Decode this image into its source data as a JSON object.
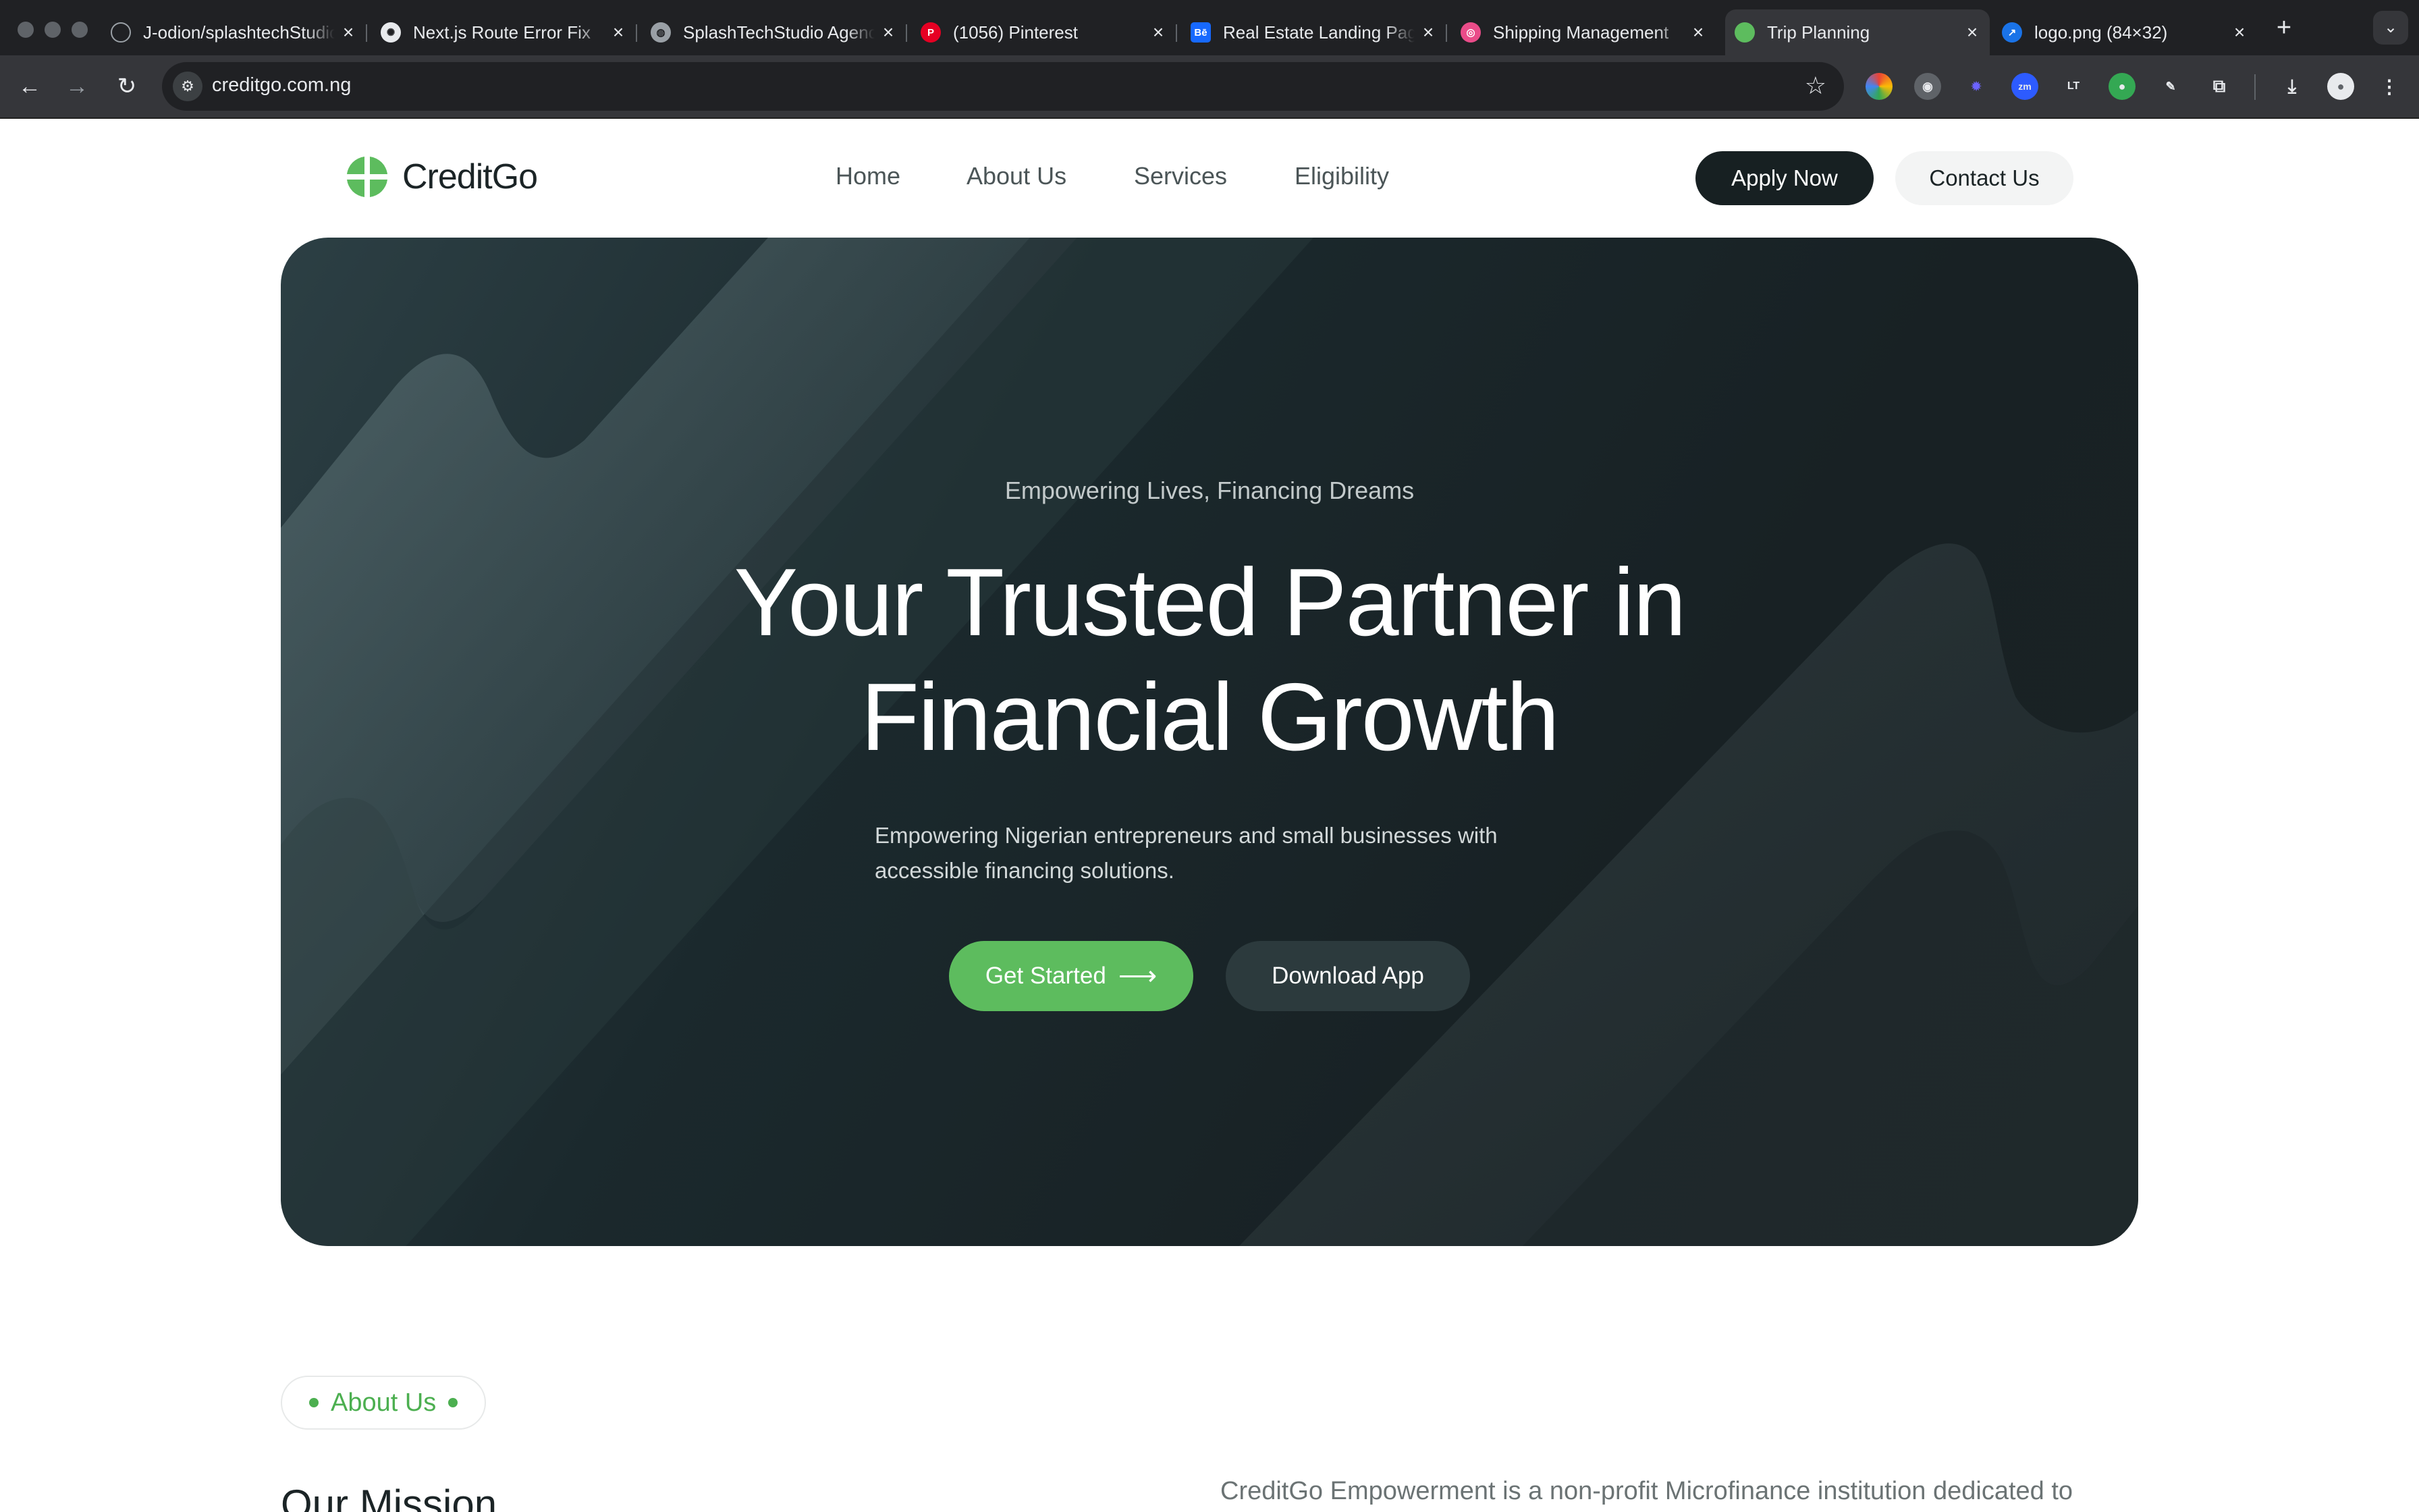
{
  "browser": {
    "tabs": [
      {
        "title": "J-odion/splashtechStudio",
        "icon": "github-icon"
      },
      {
        "title": "Next.js Route Error Fix",
        "icon": "openai-icon"
      },
      {
        "title": "SplashTechStudio Agency",
        "icon": "globe-icon"
      },
      {
        "title": "(1056) Pinterest",
        "icon": "pinterest-icon"
      },
      {
        "title": "Real Estate Landing Page",
        "icon": "behance-icon"
      },
      {
        "title": "Shipping Management",
        "icon": "dribbble-icon"
      },
      {
        "title": "Trip Planning",
        "icon": "creditgo-icon",
        "active": true
      },
      {
        "title": "logo.png (84×32)",
        "icon": "image-icon"
      }
    ],
    "url": "creditgo.com.ng",
    "tab_new": "+"
  },
  "site": {
    "brand": "CreditGo",
    "brand_color": "#5dbc5e",
    "nav": [
      "Home",
      "About Us",
      "Services",
      "Eligibility"
    ],
    "apply_label": "Apply Now",
    "contact_label": "Contact Us"
  },
  "hero": {
    "eyebrow": "Empowering Lives, Financing Dreams",
    "headline_line1": "Your Trusted Partner in",
    "headline_line2": "Financial Growth",
    "subtext_line1": "Empowering Nigerian entrepreneurs and small businesses with",
    "subtext_line2": "accessible financing solutions.",
    "primary_cta": "Get Started",
    "secondary_cta": "Download App"
  },
  "about": {
    "pill": "About Us",
    "heading": "Our Mission",
    "text": "CreditGo Empowerment is a non-profit Microfinance institution dedicated to"
  }
}
